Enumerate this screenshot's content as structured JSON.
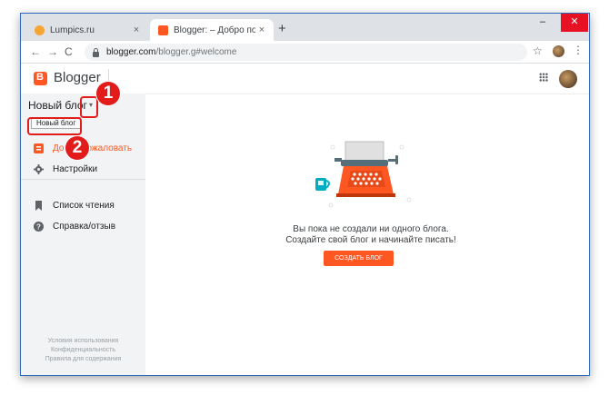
{
  "tabs": [
    {
      "title": "Lumpics.ru",
      "close": "×",
      "favicon_color": "#f4a533"
    },
    {
      "title": "Blogger: – Добро пожаловать",
      "close": "×",
      "favicon_color": "#ff5722"
    }
  ],
  "new_tab": "+",
  "window_controls": {
    "minimize": "–",
    "close": "✕"
  },
  "toolbar": {
    "back": "←",
    "forward": "→",
    "reload": "C",
    "url_host": "blogger.com",
    "url_path": "/blogger.g#welcome",
    "star": "☆",
    "menu": "⋮"
  },
  "app": {
    "brand": "Blogger"
  },
  "sidebar": {
    "blog_select": "Новый блог",
    "dropdown_tip": "Новый блог",
    "items": [
      {
        "label": "Добро пожаловать",
        "icon": "blogger-icon"
      },
      {
        "label": "Настройки",
        "icon": "gear-icon"
      },
      {
        "label": "Список чтения",
        "icon": "bookmark-icon"
      },
      {
        "label": "Справка/отзыв",
        "icon": "help-icon"
      }
    ],
    "footer": [
      "Условия использования",
      "Конфиденциальность",
      "Правила для содержания"
    ]
  },
  "main": {
    "empty_line1": "Вы пока не создали ни одного блога.",
    "empty_line2": "Создайте свой блог и начинайте писать!",
    "create_button": "СОЗДАТЬ БЛОГ"
  },
  "annotations": {
    "step1": "1",
    "step2": "2"
  },
  "colors": {
    "accent": "#ff5722",
    "annotation": "#e21b1b",
    "sidebar_bg": "#f1f3f4"
  }
}
